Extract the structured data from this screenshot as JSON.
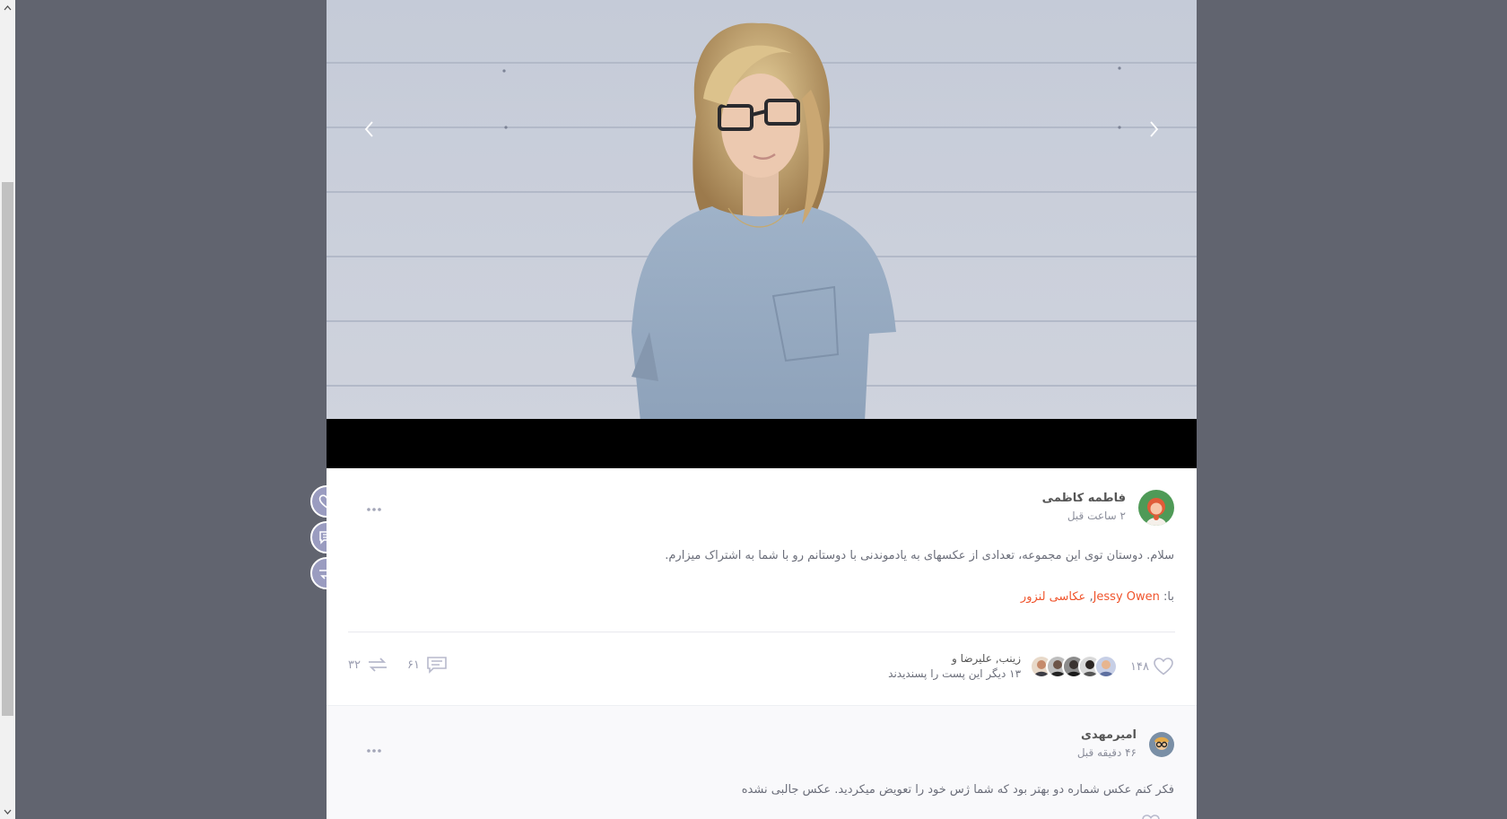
{
  "post": {
    "author_name": "فاطمه کاظمی",
    "time_ago": "۲ ساعت قبل",
    "text": "سلام. دوستان توی این مجموعه، تعدادی از عکسهای به یادموندنی با دوستانم رو با شما به اشتراک میزارم.",
    "with_label": "با:",
    "with_person": "Jessy Owen",
    "with_separator": ",",
    "with_tag": "عکاسی لنزور",
    "like_count": "۱۴۸",
    "liked_names": "زینب, علیرضا و",
    "liked_more": "۱۳ دیگر این پست را پسندیدند",
    "comment_count": "۶۱",
    "share_count": "۳۲"
  },
  "comment": {
    "author_name": "امیرمهدی",
    "time_ago": "۴۶ دقیقه قبل",
    "text": "فکر کنم عکس شماره دو بهتر بود که شما ژس خود را تعویض میکردید. عکس جالبی نشده"
  },
  "icons": {
    "prev": "chevron-left-icon",
    "next": "chevron-right-icon",
    "like": "heart-icon",
    "comment": "comment-icon",
    "share": "share-icon",
    "more": "more-dots-icon"
  },
  "colors": {
    "accent": "#f0542c",
    "float_button": "#9a9cc0",
    "backdrop": "#61646f"
  }
}
